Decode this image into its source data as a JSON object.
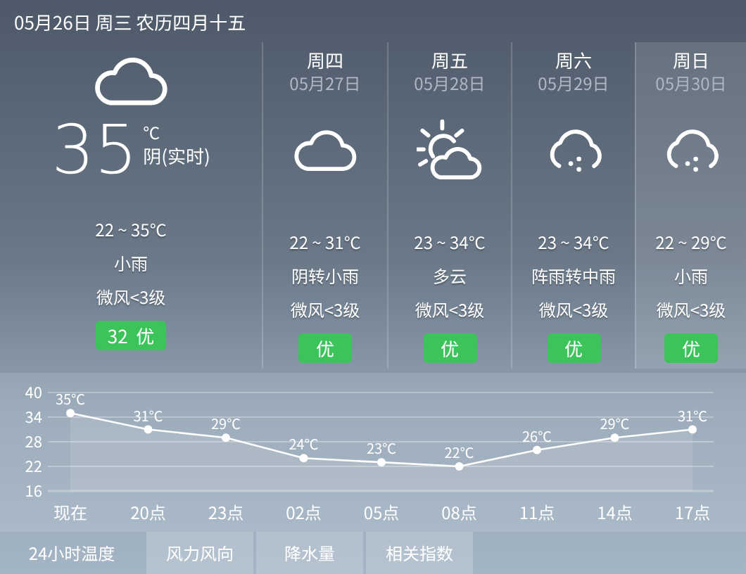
{
  "header": {
    "date": "05月26日 周三 农历四月十五"
  },
  "today": {
    "kind": "cloudy",
    "temp": "35",
    "unit": "℃",
    "desc": "阴(实时)",
    "range": "22 ~ 35℃",
    "weather": "小雨",
    "wind": "微风<3级",
    "aqi": "32  优"
  },
  "days": [
    {
      "weekday": "周四",
      "date": "05月27日",
      "kind": "cloudy",
      "range": "22 ~ 31℃",
      "weather": "阴转小雨",
      "wind": "微风<3级",
      "aqi": "优",
      "selected": false
    },
    {
      "weekday": "周五",
      "date": "05月28日",
      "kind": "partly-cloudy",
      "range": "23 ~ 34℃",
      "weather": "多云",
      "wind": "微风<3级",
      "aqi": "优",
      "selected": false
    },
    {
      "weekday": "周六",
      "date": "05月29日",
      "kind": "rain",
      "range": "23 ~ 34℃",
      "weather": "阵雨转中雨",
      "wind": "微风<3级",
      "aqi": "优",
      "selected": false
    },
    {
      "weekday": "周日",
      "date": "05月30日",
      "kind": "rain",
      "range": "22 ~ 29℃",
      "weather": "小雨",
      "wind": "微风<3级",
      "aqi": "优",
      "selected": true
    }
  ],
  "chart": {
    "chart_data": {
      "type": "area",
      "categories": [
        "现在",
        "20点",
        "23点",
        "02点",
        "05点",
        "08点",
        "11点",
        "14点",
        "17点"
      ],
      "series": [
        {
          "color": "#ffffff",
          "values": [
            35,
            31,
            29,
            24,
            23,
            22,
            26,
            29,
            31
          ]
        }
      ],
      "ylim": [
        16,
        40
      ],
      "yticks": [
        16,
        22,
        28,
        34,
        40
      ],
      "grid": true,
      "value_labels": [
        "35℃",
        "31℃",
        "29℃",
        "24℃",
        "23℃",
        "22℃",
        "26℃",
        "29℃",
        "31℃"
      ]
    }
  },
  "tabs": [
    {
      "label": "24小时温度",
      "selected": true
    },
    {
      "label": "风力风向",
      "selected": false
    },
    {
      "label": "降水量",
      "selected": false
    },
    {
      "label": "相关指数",
      "selected": false
    }
  ]
}
